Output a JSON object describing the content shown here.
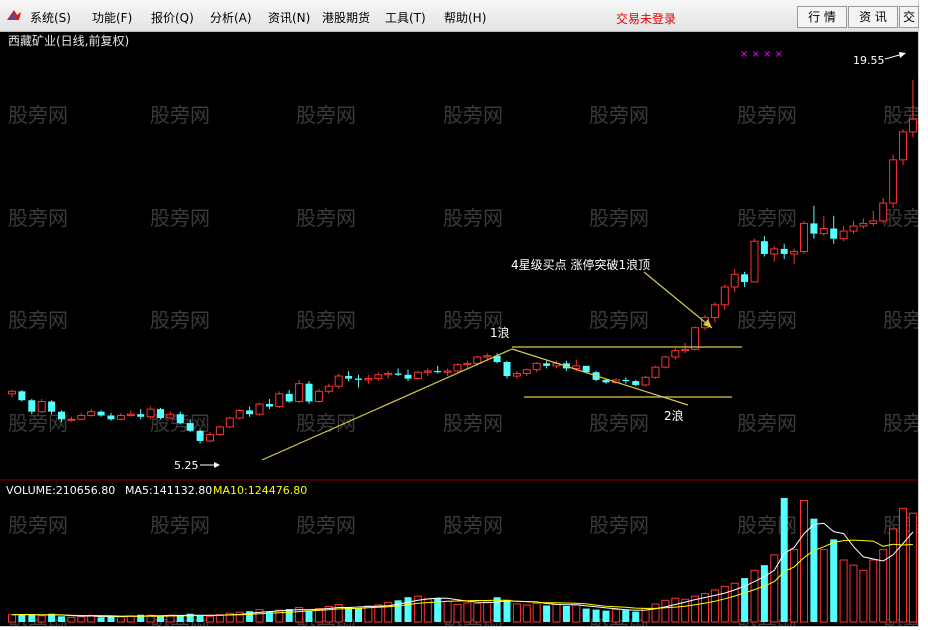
{
  "menu": {
    "items": [
      "系统(S)",
      "功能(F)",
      "报价(Q)",
      "分析(A)",
      "资讯(N)",
      "港股期货",
      "工具(T)",
      "帮助(H)"
    ],
    "status": "交易未登录",
    "right_buttons": [
      "行 情",
      "资 讯",
      "交"
    ]
  },
  "chart_data": {
    "type": "candlestick",
    "title": "西藏矿业(日线,前复权)",
    "watermark": "股旁网",
    "marker_symbols": "× × × ×",
    "price_range": [
      4.6,
      20.6
    ],
    "annotations": {
      "low_label": "5.25",
      "high_label": "19.55",
      "wave1": "1浪",
      "wave2": "2浪",
      "buy_point": "4星级买点 涨停突破1浪顶"
    },
    "candles": [
      [
        7.2,
        7.35,
        7.05,
        7.3
      ],
      [
        7.3,
        7.35,
        6.9,
        6.95
      ],
      [
        6.95,
        7.0,
        6.4,
        6.5
      ],
      [
        6.5,
        7.0,
        6.45,
        6.9
      ],
      [
        6.9,
        6.95,
        6.4,
        6.5
      ],
      [
        6.5,
        6.55,
        6.1,
        6.2
      ],
      [
        6.2,
        6.3,
        6.1,
        6.2
      ],
      [
        6.2,
        6.45,
        6.15,
        6.35
      ],
      [
        6.35,
        6.6,
        6.3,
        6.5
      ],
      [
        6.5,
        6.55,
        6.3,
        6.35
      ],
      [
        6.35,
        6.45,
        6.15,
        6.2
      ],
      [
        6.2,
        6.45,
        6.15,
        6.35
      ],
      [
        6.35,
        6.55,
        6.3,
        6.4
      ],
      [
        6.4,
        6.6,
        6.2,
        6.3
      ],
      [
        6.3,
        6.7,
        6.2,
        6.6
      ],
      [
        6.6,
        6.65,
        6.2,
        6.25
      ],
      [
        6.25,
        6.5,
        6.2,
        6.4
      ],
      [
        6.4,
        6.5,
        6.0,
        6.05
      ],
      [
        6.05,
        6.2,
        5.7,
        5.75
      ],
      [
        5.75,
        5.8,
        5.25,
        5.35
      ],
      [
        5.35,
        5.7,
        5.3,
        5.6
      ],
      [
        5.6,
        5.95,
        5.55,
        5.9
      ],
      [
        5.9,
        6.3,
        5.85,
        6.25
      ],
      [
        6.25,
        6.6,
        6.2,
        6.55
      ],
      [
        6.55,
        6.7,
        6.3,
        6.4
      ],
      [
        6.4,
        6.85,
        6.35,
        6.8
      ],
      [
        6.8,
        7.0,
        6.6,
        6.7
      ],
      [
        6.7,
        7.3,
        6.65,
        7.2
      ],
      [
        7.2,
        7.35,
        6.85,
        6.9
      ],
      [
        6.9,
        7.75,
        6.85,
        7.6
      ],
      [
        7.6,
        7.7,
        6.8,
        6.9
      ],
      [
        6.9,
        7.4,
        6.85,
        7.3
      ],
      [
        7.3,
        7.6,
        7.2,
        7.5
      ],
      [
        7.5,
        8.0,
        7.4,
        7.9
      ],
      [
        7.9,
        8.1,
        7.7,
        7.8
      ],
      [
        7.8,
        7.95,
        7.45,
        7.75
      ],
      [
        7.75,
        7.95,
        7.6,
        7.8
      ],
      [
        7.8,
        8.05,
        7.7,
        7.95
      ],
      [
        7.95,
        8.1,
        7.8,
        8.0
      ],
      [
        8.0,
        8.2,
        7.9,
        7.95
      ],
      [
        7.95,
        8.15,
        7.7,
        7.8
      ],
      [
        7.8,
        8.1,
        7.75,
        8.05
      ],
      [
        8.05,
        8.2,
        7.9,
        8.1
      ],
      [
        8.1,
        8.3,
        8.0,
        8.05
      ],
      [
        8.05,
        8.2,
        7.9,
        8.1
      ],
      [
        8.1,
        8.4,
        8.05,
        8.35
      ],
      [
        8.35,
        8.5,
        8.2,
        8.4
      ],
      [
        8.4,
        8.7,
        8.3,
        8.65
      ],
      [
        8.65,
        8.8,
        8.5,
        8.7
      ],
      [
        8.7,
        8.8,
        8.4,
        8.45
      ],
      [
        8.45,
        8.5,
        7.8,
        7.9
      ],
      [
        7.9,
        8.1,
        7.8,
        8.0
      ],
      [
        8.0,
        8.2,
        7.9,
        8.15
      ],
      [
        8.15,
        8.45,
        8.05,
        8.4
      ],
      [
        8.4,
        8.5,
        8.2,
        8.3
      ],
      [
        8.3,
        8.5,
        8.2,
        8.4
      ],
      [
        8.4,
        8.5,
        8.1,
        8.2
      ],
      [
        8.2,
        8.55,
        8.1,
        8.3
      ],
      [
        8.3,
        8.3,
        8.0,
        8.05
      ],
      [
        8.05,
        8.1,
        7.7,
        7.75
      ],
      [
        7.75,
        7.8,
        7.6,
        7.65
      ],
      [
        7.65,
        7.8,
        7.6,
        7.75
      ],
      [
        7.75,
        7.85,
        7.6,
        7.7
      ],
      [
        7.7,
        7.75,
        7.5,
        7.55
      ],
      [
        7.55,
        7.9,
        7.5,
        7.85
      ],
      [
        7.85,
        8.3,
        7.8,
        8.25
      ],
      [
        8.25,
        8.7,
        8.2,
        8.65
      ],
      [
        8.65,
        9.0,
        8.55,
        8.9
      ],
      [
        8.9,
        9.2,
        8.8,
        8.95
      ],
      [
        8.95,
        9.85,
        8.9,
        9.8
      ],
      [
        9.8,
        10.3,
        9.7,
        10.2
      ],
      [
        10.2,
        10.8,
        10.0,
        10.7
      ],
      [
        10.7,
        11.5,
        10.5,
        11.4
      ],
      [
        11.4,
        12.1,
        11.2,
        11.9
      ],
      [
        11.9,
        12.0,
        11.4,
        11.6
      ],
      [
        11.6,
        13.3,
        11.6,
        13.2
      ],
      [
        13.2,
        13.4,
        12.6,
        12.7
      ],
      [
        12.7,
        13.0,
        12.4,
        12.9
      ],
      [
        12.9,
        13.1,
        12.5,
        12.7
      ],
      [
        12.7,
        12.9,
        12.3,
        12.8
      ],
      [
        12.8,
        14.0,
        12.7,
        13.9
      ],
      [
        13.9,
        14.6,
        13.3,
        13.5
      ],
      [
        13.5,
        14.2,
        13.4,
        13.7
      ],
      [
        13.7,
        14.2,
        13.1,
        13.3
      ],
      [
        13.3,
        13.8,
        13.2,
        13.6
      ],
      [
        13.6,
        14.0,
        13.5,
        13.8
      ],
      [
        13.8,
        14.1,
        13.7,
        13.9
      ],
      [
        13.9,
        14.4,
        13.8,
        14.0
      ],
      [
        14.0,
        14.9,
        13.9,
        14.7
      ],
      [
        14.7,
        16.6,
        14.5,
        16.4
      ],
      [
        16.4,
        17.6,
        16.2,
        17.5
      ],
      [
        17.5,
        19.55,
        17.3,
        18.0
      ]
    ],
    "volume": {
      "label": "VOLUME:210656.80",
      "ma5_label": "MA5:141132.80",
      "ma10_label": "MA10:124476.80",
      "max": 240000,
      "values": [
        14000,
        15000,
        14000,
        12000,
        16000,
        11000,
        9000,
        10000,
        13000,
        9000,
        11000,
        10000,
        12000,
        14000,
        13000,
        12000,
        13000,
        12000,
        16000,
        13000,
        11000,
        14000,
        17000,
        19000,
        21000,
        24000,
        20000,
        23000,
        25000,
        28000,
        22000,
        26000,
        30000,
        34000,
        28000,
        27000,
        31000,
        33000,
        38000,
        42000,
        48000,
        50000,
        45000,
        46000,
        40000,
        34000,
        37000,
        36000,
        39000,
        48000,
        43000,
        35000,
        33000,
        36000,
        32000,
        34000,
        31000,
        33000,
        26000,
        24000,
        22000,
        24000,
        23000,
        20000,
        26000,
        35000,
        42000,
        46000,
        44000,
        50000,
        55000,
        62000,
        69000,
        75000,
        85000,
        100000,
        110000,
        130000,
        240000,
        140000,
        235000,
        200000,
        140000,
        160000,
        120000,
        110000,
        100000,
        120000,
        140000,
        180000,
        220000,
        210657
      ]
    }
  },
  "colors": {
    "up": "#ff3232",
    "down": "#54ffff",
    "ma5": "#ffffff",
    "ma10": "#ffff00",
    "annotation": "#d6c94a",
    "divider": "#8b0000",
    "watermark": "#3a3a3a"
  }
}
